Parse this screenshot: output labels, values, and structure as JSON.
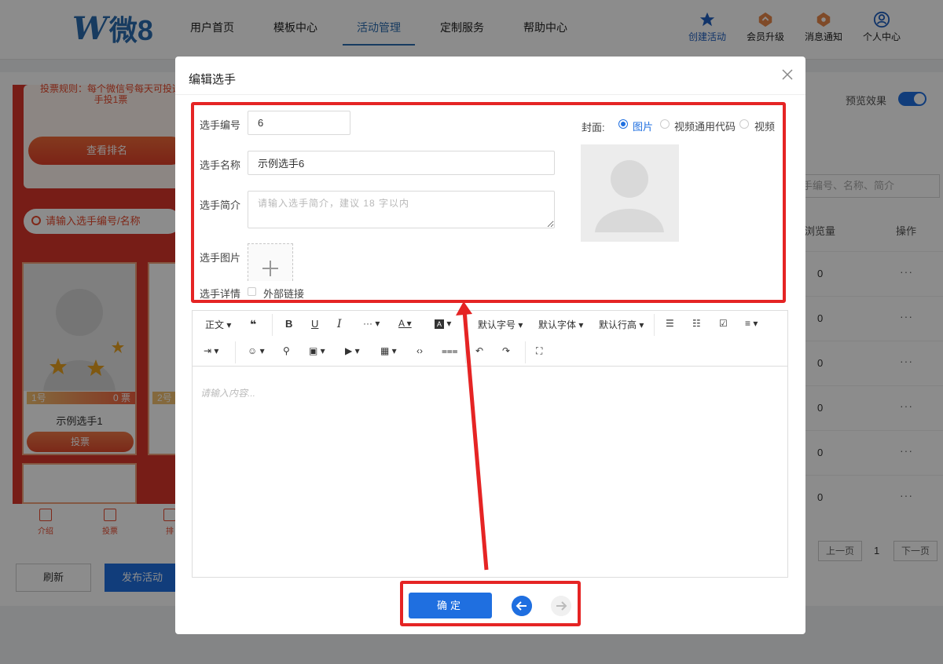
{
  "app": {
    "logo_text": "微8",
    "logo_letter": "W"
  },
  "nav": [
    {
      "label": "用户首页"
    },
    {
      "label": "模板中心"
    },
    {
      "label": "活动管理"
    },
    {
      "label": "定制服务"
    },
    {
      "label": "帮助中心"
    }
  ],
  "right_nav": [
    {
      "label": "创建活动",
      "icon": "star-icon"
    },
    {
      "label": "会员升级",
      "icon": "upgrade-icon"
    },
    {
      "label": "消息通知",
      "icon": "notification-icon"
    },
    {
      "label": "个人中心",
      "icon": "user-icon"
    }
  ],
  "phone_preview": {
    "rule_text": "投票规则：每个微信号每天可投选手投1票",
    "rank_button": "查看排名",
    "search_placeholder": "请输入选手编号/名称",
    "card1": {
      "number": "1号",
      "votes": "0 票",
      "name": "示例选手1",
      "vote_button": "投票"
    },
    "card2": {
      "number": "2号"
    },
    "tabs": [
      {
        "label": "介绍"
      },
      {
        "label": "投票"
      },
      {
        "label": "排"
      }
    ]
  },
  "page_actions": {
    "refresh": "刷新",
    "publish": "发布活动"
  },
  "right_panel": {
    "preview_label": "预览效果",
    "preview_enabled": true,
    "search_placeholder": "手编号、名称、简介",
    "col_views": "浏览量",
    "col_ops": "操作",
    "rows": [
      {
        "views": "0",
        "ops": "···"
      },
      {
        "views": "0",
        "ops": "···"
      },
      {
        "views": "0",
        "ops": "···"
      },
      {
        "views": "0",
        "ops": "···"
      },
      {
        "views": "0",
        "ops": "···"
      },
      {
        "views": "0",
        "ops": "···"
      }
    ],
    "pagination": {
      "prev": "上一页",
      "current": "1",
      "next": "下一页"
    }
  },
  "modal": {
    "title": "编辑选手",
    "fields": {
      "number_label": "选手编号",
      "number_value": "6",
      "name_label": "选手名称",
      "name_value": "示例选手6",
      "intro_label": "选手简介",
      "intro_placeholder": "请输入选手简介，建议 18 字以内",
      "image_label": "选手图片",
      "detail_label": "选手详情",
      "external_link_label": "外部链接"
    },
    "cover": {
      "label": "封面:",
      "options": [
        "图片",
        "视频通用代码",
        "视频"
      ],
      "selected": "图片"
    },
    "editor": {
      "toolbar_row1": [
        "正文",
        "引用",
        "粗体",
        "下划线",
        "斜体",
        "更多",
        "字体颜色",
        "背景色",
        "默认字号",
        "默认字体",
        "默认行高",
        "无序列表",
        "有序列表",
        "待办",
        "对齐"
      ],
      "paragraph_label": "正文",
      "font_size_label": "默认字号",
      "font_family_label": "默认字体",
      "line_height_label": "默认行高",
      "placeholder": "请输入内容..."
    },
    "confirm_button": "确定"
  },
  "colors": {
    "primary": "#1f6fe0",
    "annotation": "#e52424",
    "theme_red": "#d9362b"
  }
}
